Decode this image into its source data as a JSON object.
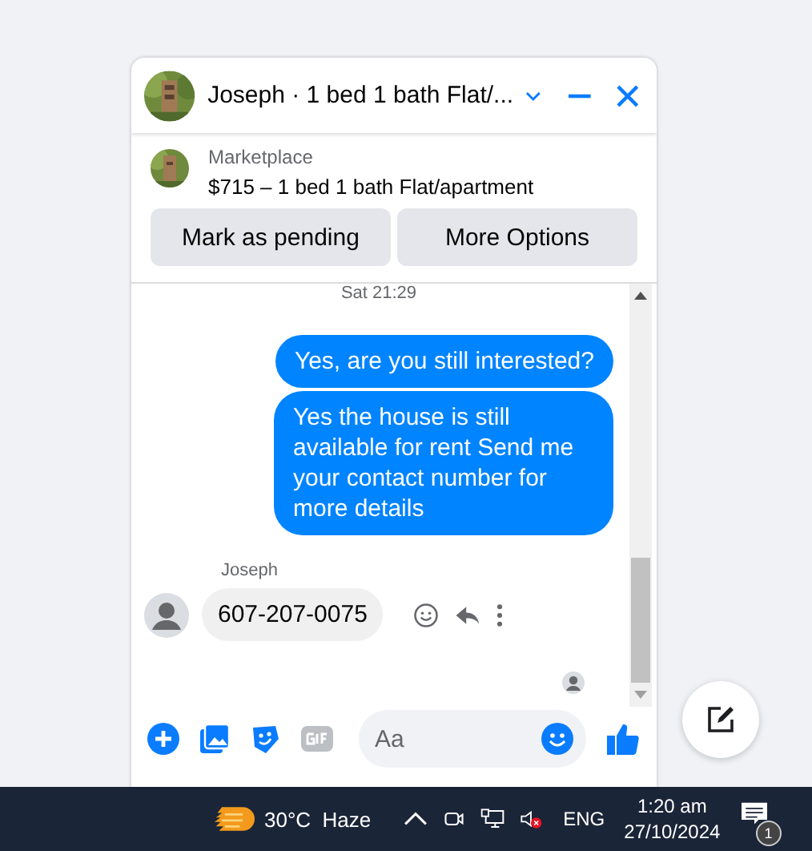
{
  "chat": {
    "title": "Joseph · 1 bed 1 bath Flat/...",
    "listing": {
      "source": "Marketplace",
      "title": "$715 – 1 bed 1 bath Flat/apartment"
    },
    "actions": [
      "Mark as pending",
      "More Options"
    ],
    "messages": [
      {
        "kind": "time",
        "text": "Sat 21:29"
      },
      {
        "kind": "outgoing",
        "text": "Yes, are you still interested?"
      },
      {
        "kind": "outgoing",
        "text": "Yes the house is still available for rent Send me your contact number for more details"
      },
      {
        "kind": "sender",
        "text": "Joseph"
      },
      {
        "kind": "incoming",
        "text": "607-207-0075"
      }
    ],
    "composer": {
      "placeholder": "Aa"
    }
  },
  "taskbar": {
    "weather": "30°C  Haze",
    "language": "ENG",
    "time": "1:20 am",
    "date": "27/10/2024",
    "notifications": "1"
  }
}
